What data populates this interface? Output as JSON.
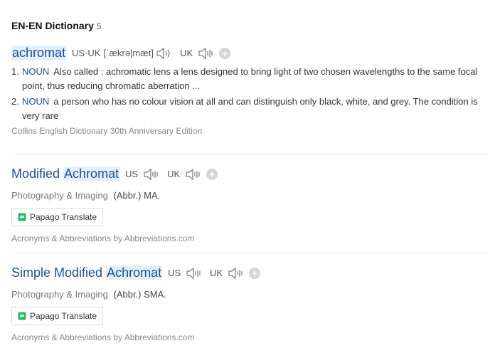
{
  "header": {
    "title": "EN-EN Dictionary",
    "count": "5"
  },
  "entries": [
    {
      "word": "achromat",
      "us_uk_label": "US·UK",
      "phonetic": "[ˈækrə|mæt]",
      "uk_label": "UK",
      "definitions": [
        {
          "num": "1.",
          "pos": "NOUN",
          "text": "Also called : achromatic lens a lens designed to bring light of two chosen wavelengths to the same focal point, thus reducing chromatic aberration ..."
        },
        {
          "num": "2.",
          "pos": "NOUN",
          "text": "a person who has no colour vision at all and can distinguish only black, white, and grey. The condition is very rare"
        }
      ],
      "source": "Collins English Dictionary 30th Anniversary Edition"
    },
    {
      "word_prefix": "Modified ",
      "word_highlight": "Achromat",
      "us_label": "US",
      "uk_label": "UK",
      "domain": "Photography & Imaging",
      "abbr": "(Abbr.) MA.",
      "translate_label": "Papago Translate",
      "source": "Acronyms & Abbreviations by Abbreviations.com"
    },
    {
      "word_prefix": "Simple Modified ",
      "word_highlight": "Achromat",
      "us_label": "US",
      "uk_label": "UK",
      "domain": "Photography & Imaging",
      "abbr": "(Abbr.) SMA.",
      "translate_label": "Papago Translate",
      "source": "Acronyms & Abbreviations by Abbreviations.com"
    }
  ],
  "icons": {
    "speaker": "speaker-icon",
    "add": "plus-icon",
    "papago": "papago-icon"
  },
  "colors": {
    "link": "#1a4fa0",
    "highlight": "#e3f0fb",
    "papago": "#18c06b"
  }
}
